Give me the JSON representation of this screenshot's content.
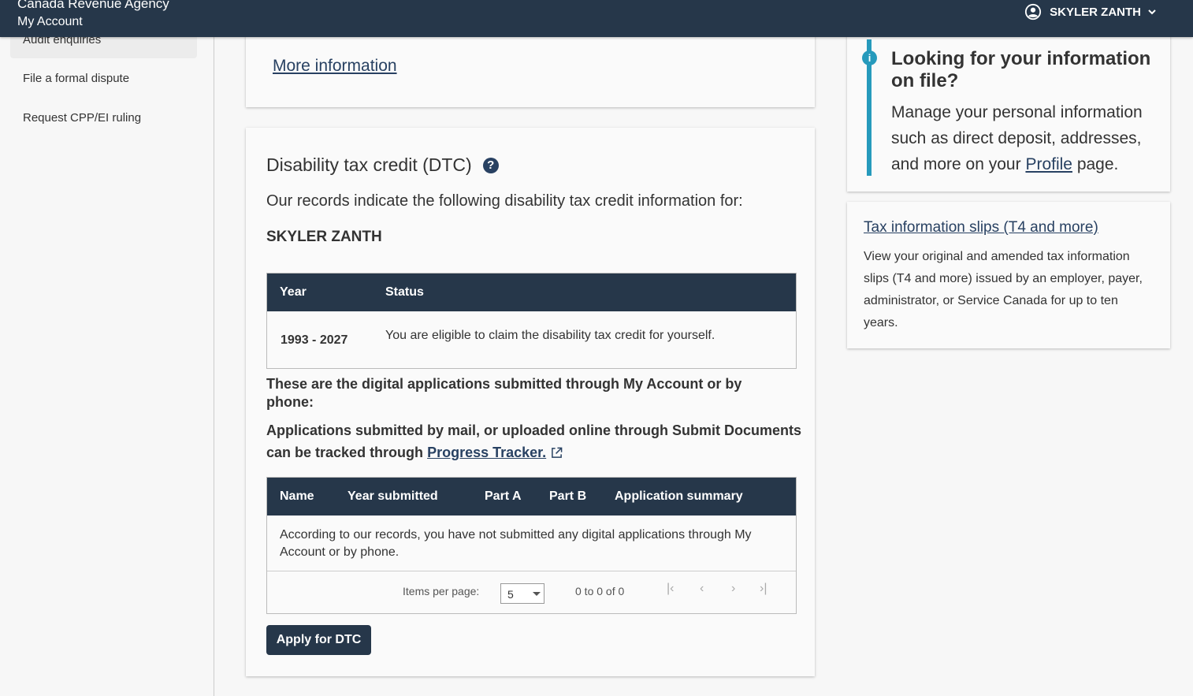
{
  "header": {
    "org": "Canada Revenue Agency",
    "account": "My Account",
    "user": "SKYLER ZANTH"
  },
  "leftnav": {
    "active_item": "Audit enquiries",
    "items": [
      "File a formal dispute",
      "Request CPP/EI ruling"
    ]
  },
  "card_top": {
    "link": "More information"
  },
  "dtc": {
    "title": "Disability tax credit (DTC)",
    "help_symbol": "?",
    "records_text": "Our records indicate the following disability tax credit information for:",
    "name": "SKYLER ZANTH",
    "table": {
      "headers": [
        "Year",
        "Status"
      ],
      "row": {
        "year": "1993 - 2027",
        "status": "You are eligible to claim the disability tax credit for yourself."
      }
    },
    "digital_apps_text": "These are the digital applications submitted through My Account or by phone:",
    "mail_apps_text": "Applications submitted by mail, or uploaded online through Submit Documents can be tracked through",
    "tracker_link": "Progress Tracker.",
    "apps_table": {
      "headers": [
        "Name",
        "Year submitted",
        "Part A",
        "Part B",
        "Application summary"
      ],
      "empty_message": "According to our records, you have not submitted any digital applications through My Account or by phone.",
      "items_per_page_label": "Items per page:",
      "items_per_page_value": "5",
      "range_text": "0 to 0 of 0",
      "first": "|‹",
      "prev": "‹",
      "next": "›",
      "last": "›|"
    },
    "apply_button": "Apply for DTC"
  },
  "info_card": {
    "icon": "i",
    "heading": "Looking for your information on file?",
    "text_before": "Manage your personal information such as direct deposit, addresses, and more on your",
    "link": "Profile",
    "text_after": "page."
  },
  "slips_card": {
    "link": "Tax information slips (T4 and more)",
    "text": "View your original and amended tax information slips (T4 and more) issued by an employer, payer, administrator, or Service Canada for up to ten years."
  },
  "colors": {
    "navy": "#26374a",
    "link": "#284162",
    "info": "#269abc"
  }
}
